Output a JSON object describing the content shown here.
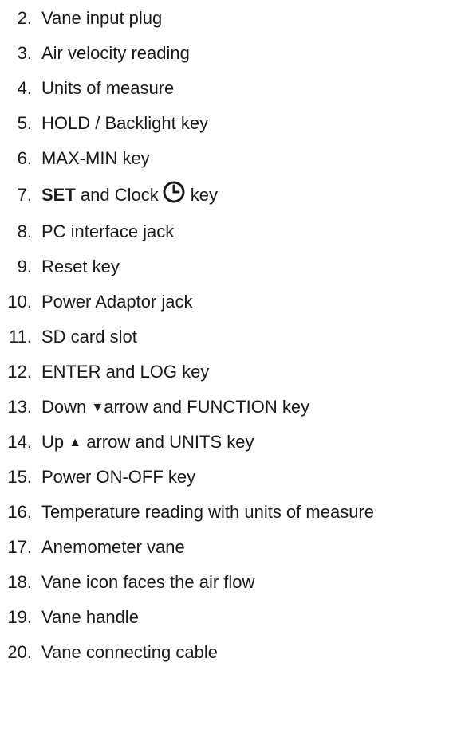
{
  "items": [
    {
      "num": "2.",
      "text": "Vane input plug"
    },
    {
      "num": "3.",
      "text": "Air velocity reading"
    },
    {
      "num": "4.",
      "text": "Units of measure"
    },
    {
      "num": "5.",
      "text": "HOLD / Backlight key"
    },
    {
      "num": "6.",
      "text": "MAX-MIN key"
    },
    {
      "num": "7.",
      "bold": "SET",
      "text_mid": " and Clock",
      "text_end": "key",
      "icon": "clock-icon"
    },
    {
      "num": "8.",
      "text": "PC interface jack"
    },
    {
      "num": "9.",
      "text": "Reset key"
    },
    {
      "num": "10.",
      "text": "Power Adaptor jack"
    },
    {
      "num": "11.",
      "text": "SD card slot"
    },
    {
      "num": "12.",
      "text": "ENTER and LOG key"
    },
    {
      "num": "13.",
      "text_pre": "Down ",
      "arrow": "▼",
      "text_post": "arrow and FUNCTION key"
    },
    {
      "num": "14.",
      "text_pre": "Up ",
      "arrow": "▲",
      "text_post": " arrow and UNITS key"
    },
    {
      "num": "15.",
      "text": "Power ON-OFF key"
    },
    {
      "num": "16.",
      "text": "Temperature reading with units of measure"
    },
    {
      "num": "17.",
      "text": "Anemometer vane"
    },
    {
      "num": "18.",
      "text": "Vane icon faces the air flow"
    },
    {
      "num": "19.",
      "text": "Vane handle"
    },
    {
      "num": "20.",
      "text": "Vane connecting cable"
    }
  ]
}
